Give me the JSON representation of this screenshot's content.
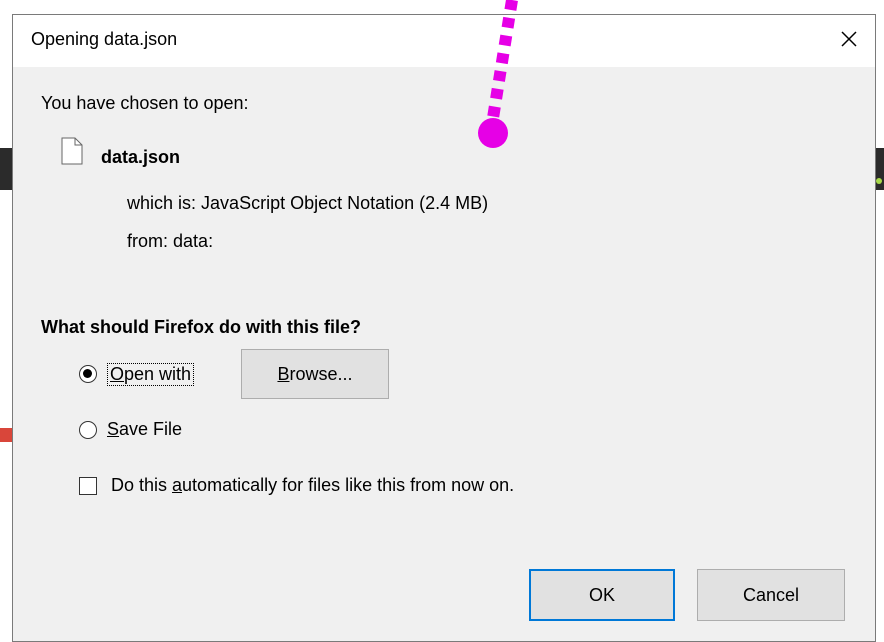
{
  "dialog": {
    "title": "Opening data.json",
    "chosen_label": "You have chosen to open:",
    "file_name": "data.json",
    "which_is_label": "which is:",
    "file_type": "JavaScript Object Notation (2.4 MB)",
    "from_label": "from:",
    "from_value": "data:",
    "question": "What should Firefox do with this file?",
    "open_with": {
      "mnemonic": "O",
      "rest": "pen with"
    },
    "browse": {
      "mnemonic": "B",
      "rest": "rowse..."
    },
    "save_file": {
      "mnemonic": "S",
      "rest": "ave File"
    },
    "auto": {
      "before": "Do this ",
      "mnemonic": "a",
      "rest": "utomatically for files like this from now on."
    },
    "ok_label": "OK",
    "cancel_label": "Cancel"
  },
  "colors": {
    "annotation": "#e600e6",
    "ok_border": "#0078d7"
  }
}
